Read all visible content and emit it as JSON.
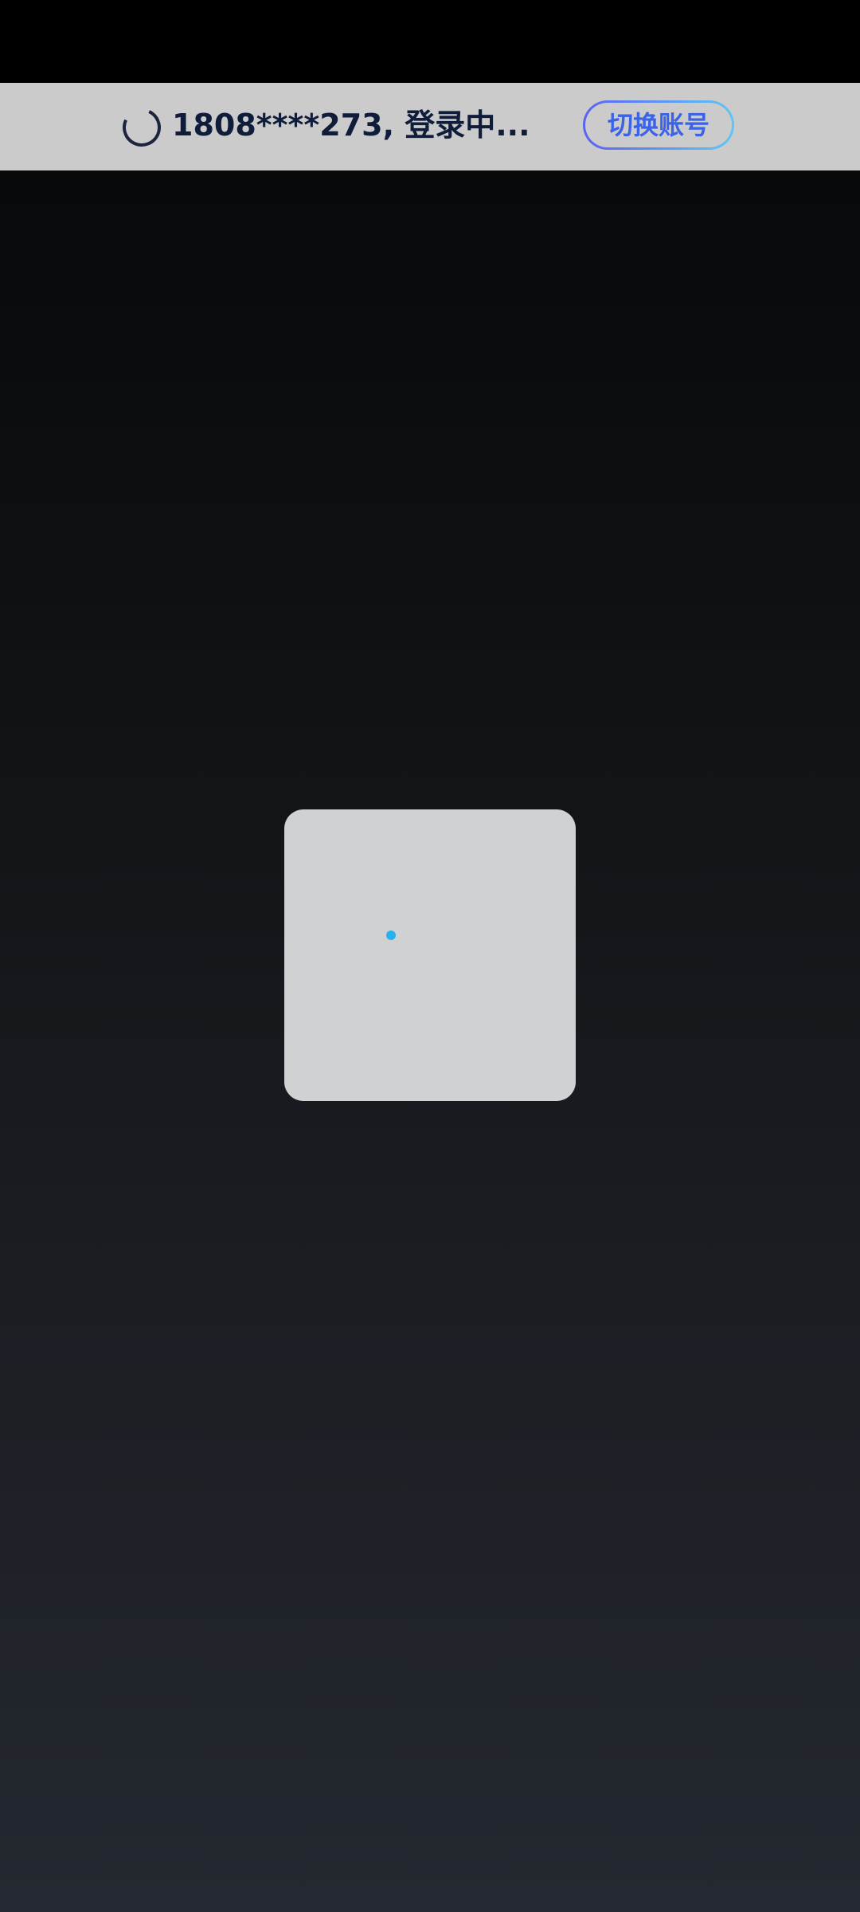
{
  "banner": {
    "account_status": "1808****273, 登录中...",
    "switch_label": "切换账号"
  },
  "icons": {
    "spinner": "loading-spinner-icon",
    "dot": "loading-dot"
  },
  "colors": {
    "banner_bg": "#cbcbcb",
    "text": "#0f1c3a",
    "button_text": "#3a63e8",
    "button_border_start": "#5b62f0",
    "button_border_end": "#5fc6f5",
    "dot": "#27b1ef",
    "card_bg": "#d0d1d2"
  }
}
